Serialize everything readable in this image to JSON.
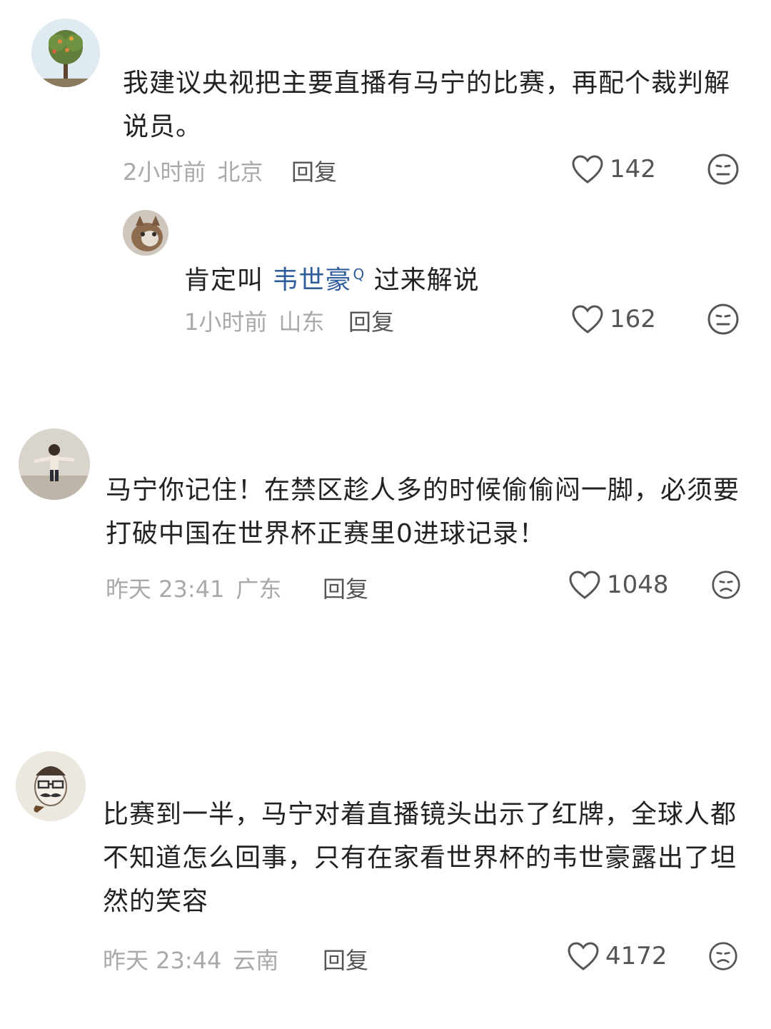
{
  "comments": [
    {
      "text": "我建议央视把主要直播有马宁的比赛，再配个裁判解说员。",
      "time": "2小时前",
      "location": "北京",
      "reply_label": "回复",
      "likes": "142",
      "avatar_icon": "tree-avatar-icon"
    },
    {
      "text_prefix": "肯定叫 ",
      "mention": "韦世豪",
      "mention_marker": "Q",
      "text_suffix": " 过来解说",
      "time": "1小时前",
      "location": "山东",
      "reply_label": "回复",
      "likes": "162",
      "avatar_icon": "cat-avatar-icon"
    },
    {
      "text": "马宁你记住！在禁区趁人多的时候偷偷闷一脚，必须要打破中国在世界杯正赛里0进球记录！",
      "time": "昨天 23:41",
      "location": "广东",
      "reply_label": "回复",
      "likes": "1048",
      "avatar_icon": "child-avatar-icon"
    },
    {
      "text": "比赛到一半，马宁对着直播镜头出示了红牌，全球人都不知道怎么回事，只有在家看世界杯的韦世豪露出了坦然的笑容",
      "time": "昨天 23:44",
      "location": "云南",
      "reply_label": "回复",
      "likes": "4172",
      "avatar_icon": "mustache-man-avatar-icon"
    }
  ],
  "colors": {
    "text": "#222222",
    "meta": "#a9a9a9",
    "mention": "#2f5c9a",
    "icon": "#555555"
  }
}
